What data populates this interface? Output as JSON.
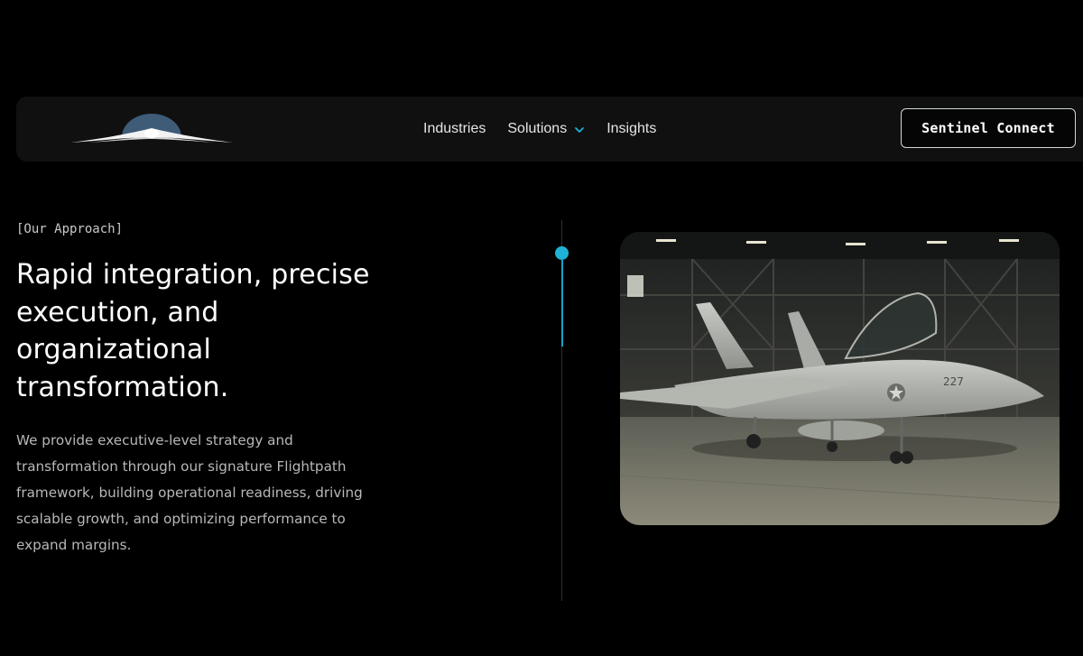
{
  "navbar": {
    "logo_name": "winged-emblem-logo",
    "links": [
      {
        "label": "Industries",
        "has_dropdown": false
      },
      {
        "label": "Solutions",
        "has_dropdown": true
      },
      {
        "label": "Insights",
        "has_dropdown": false
      }
    ],
    "cta_label": "Sentinel Connect"
  },
  "hero": {
    "eyebrow": "[Our Approach]",
    "headline_lines": [
      "Rapid integration, precise",
      "execution, and",
      "organizational",
      "transformation."
    ],
    "body_lines": [
      "We provide executive-level strategy and",
      "transformation through our signature Flightpath",
      "framework, building operational readiness, driving",
      "scalable growth, and optimizing performance to",
      "expand margins."
    ],
    "image": {
      "subject": "fighter-jet-in-hangar",
      "tail_number": "227"
    }
  },
  "colors": {
    "background": "#000000",
    "navbar_bg": "#101010",
    "accent": "#1fb1d6",
    "chevron": "#1fb1d6",
    "text_primary": "#ffffff",
    "text_secondary": "#b8b8b8"
  }
}
